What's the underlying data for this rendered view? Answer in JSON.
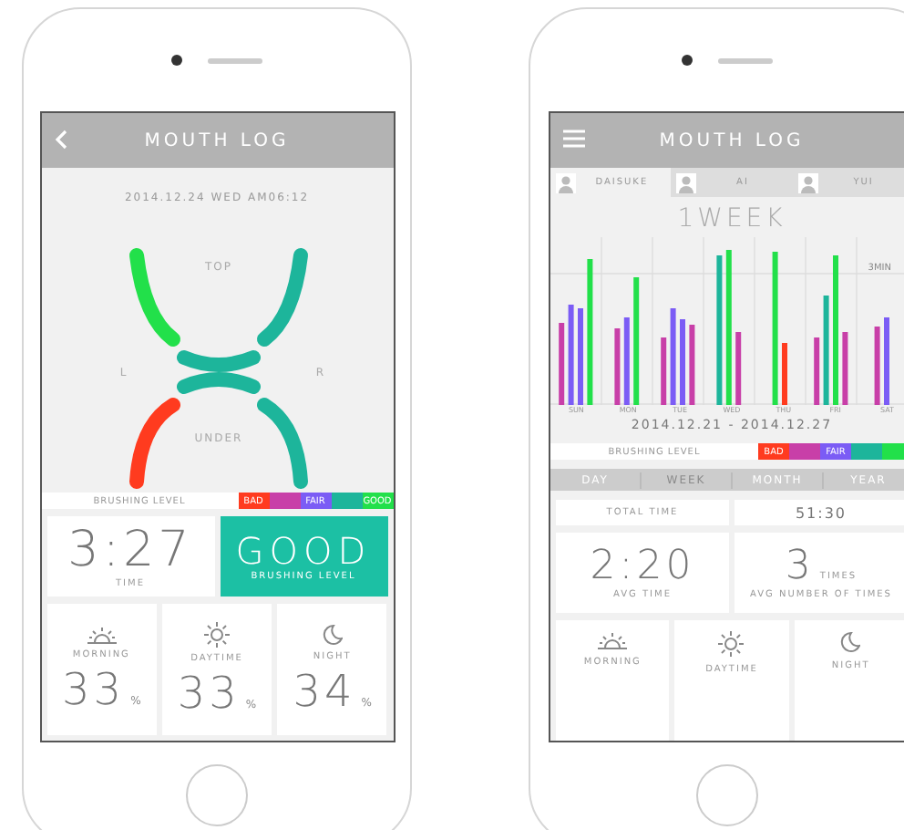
{
  "left_screen": {
    "title": "MOUTH LOG",
    "date": "2014.12.24 WED AM06:12",
    "mouth": {
      "top_label": "TOP",
      "left_label": "L",
      "right_label": "R",
      "under_label": "UNDER",
      "segments": [
        {
          "color": "#22e04a"
        },
        {
          "color": "#1db59b"
        },
        {
          "color": "#1db59b"
        },
        {
          "color": "#ff3b1f"
        },
        {
          "color": "#1db59b"
        },
        {
          "color": "#1db59b"
        }
      ]
    },
    "legend": {
      "title": "BRUSHING LEVEL",
      "levels": [
        {
          "label": "BAD",
          "color": "#ff3b1f"
        },
        {
          "color": "#c83fa8"
        },
        {
          "label": "FAIR",
          "color": "#7b5cf5"
        },
        {
          "color": "#1db59b"
        },
        {
          "label": "GOOD",
          "color": "#22e04a"
        }
      ]
    },
    "time": {
      "value": "3:27",
      "label": "TIME"
    },
    "result": {
      "value": "GOOD",
      "label": "BRUSHING LEVEL",
      "color": "#1cc0a4"
    },
    "day_parts": [
      {
        "label": "MORNING",
        "value": "33",
        "unit": "%"
      },
      {
        "label": "DAYTIME",
        "value": "33",
        "unit": "%"
      },
      {
        "label": "NIGHT",
        "value": "34",
        "unit": "%"
      }
    ]
  },
  "right_screen": {
    "title": "MOUTH LOG",
    "profiles": [
      {
        "name": "DAISUKE",
        "selected": true
      },
      {
        "name": "AI",
        "selected": false
      },
      {
        "name": "YUI",
        "selected": false
      }
    ],
    "heading": "1WEEK",
    "gridline_label": "3MIN",
    "days": [
      "SUN",
      "MON",
      "TUE",
      "WED",
      "THU",
      "FRI",
      "SAT"
    ],
    "date_range": "2014.12.21 - 2014.12.27",
    "legend": {
      "title": "BRUSHING LEVEL",
      "levels": [
        {
          "label": "BAD",
          "color": "#ff3b1f"
        },
        {
          "color": "#c83fa8"
        },
        {
          "label": "FAIR",
          "color": "#7b5cf5"
        },
        {
          "color": "#1db59b"
        },
        {
          "color": "#22e04a"
        }
      ]
    },
    "periods": [
      {
        "label": "DAY",
        "selected": false
      },
      {
        "label": "WEEK",
        "selected": true
      },
      {
        "label": "MONTH",
        "selected": false
      },
      {
        "label": "YEAR",
        "selected": false
      }
    ],
    "total": {
      "label": "TOTAL TIME",
      "value": "51:30"
    },
    "avg_time": {
      "value": "2:20",
      "label": "AVG TIME"
    },
    "avg_count": {
      "value": "3",
      "unit": "TIMES",
      "label": "AVG NUMBER OF TIMES"
    },
    "day_parts": [
      {
        "label": "MORNING"
      },
      {
        "label": "DAYTIME"
      },
      {
        "label": "NIGHT"
      }
    ]
  }
}
